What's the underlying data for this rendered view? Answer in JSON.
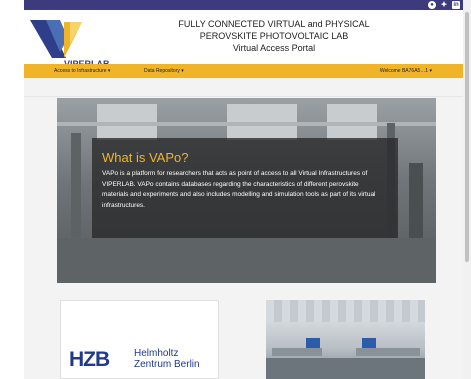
{
  "header": {
    "line1": "FULLY CONNECTED VIRTUAL and PHYSICAL",
    "line2": "PEROVSKITE PHOTOVOLTAIC LAB",
    "line3": "Virtual Access Portal",
    "logo_text": "VIPERLAB"
  },
  "social": {
    "github": "●",
    "twitter": "✦",
    "linkedin": "in",
    "instagram": "◎"
  },
  "nav": {
    "access_label": "Access to Infrastructure ▾",
    "repository_label": "Data Repository ▾",
    "welcome_label": "Welcome BA76A5…1 ▾"
  },
  "hero": {
    "title": "What is VAPo?",
    "text": "VAPo is a platform for researchers that acts as point of access to all Virtual Infrastructures of VIPERLAB. VAPo contains databases regarding the characteristics of different perovskite materials and experiments and also includes modelling and simulation tools as part of its virtual infrastructures."
  },
  "cards": {
    "hzb_mark": "HZB",
    "hzb_name_line1": "Helmholtz",
    "hzb_name_line2": "Zentrum Berlin"
  },
  "colors": {
    "nav_yellow": "#f0b429",
    "topbar_purple": "#3d3b7e",
    "logo_blue": "#2e3e8a",
    "hzb_blue": "#1f3a8a"
  }
}
